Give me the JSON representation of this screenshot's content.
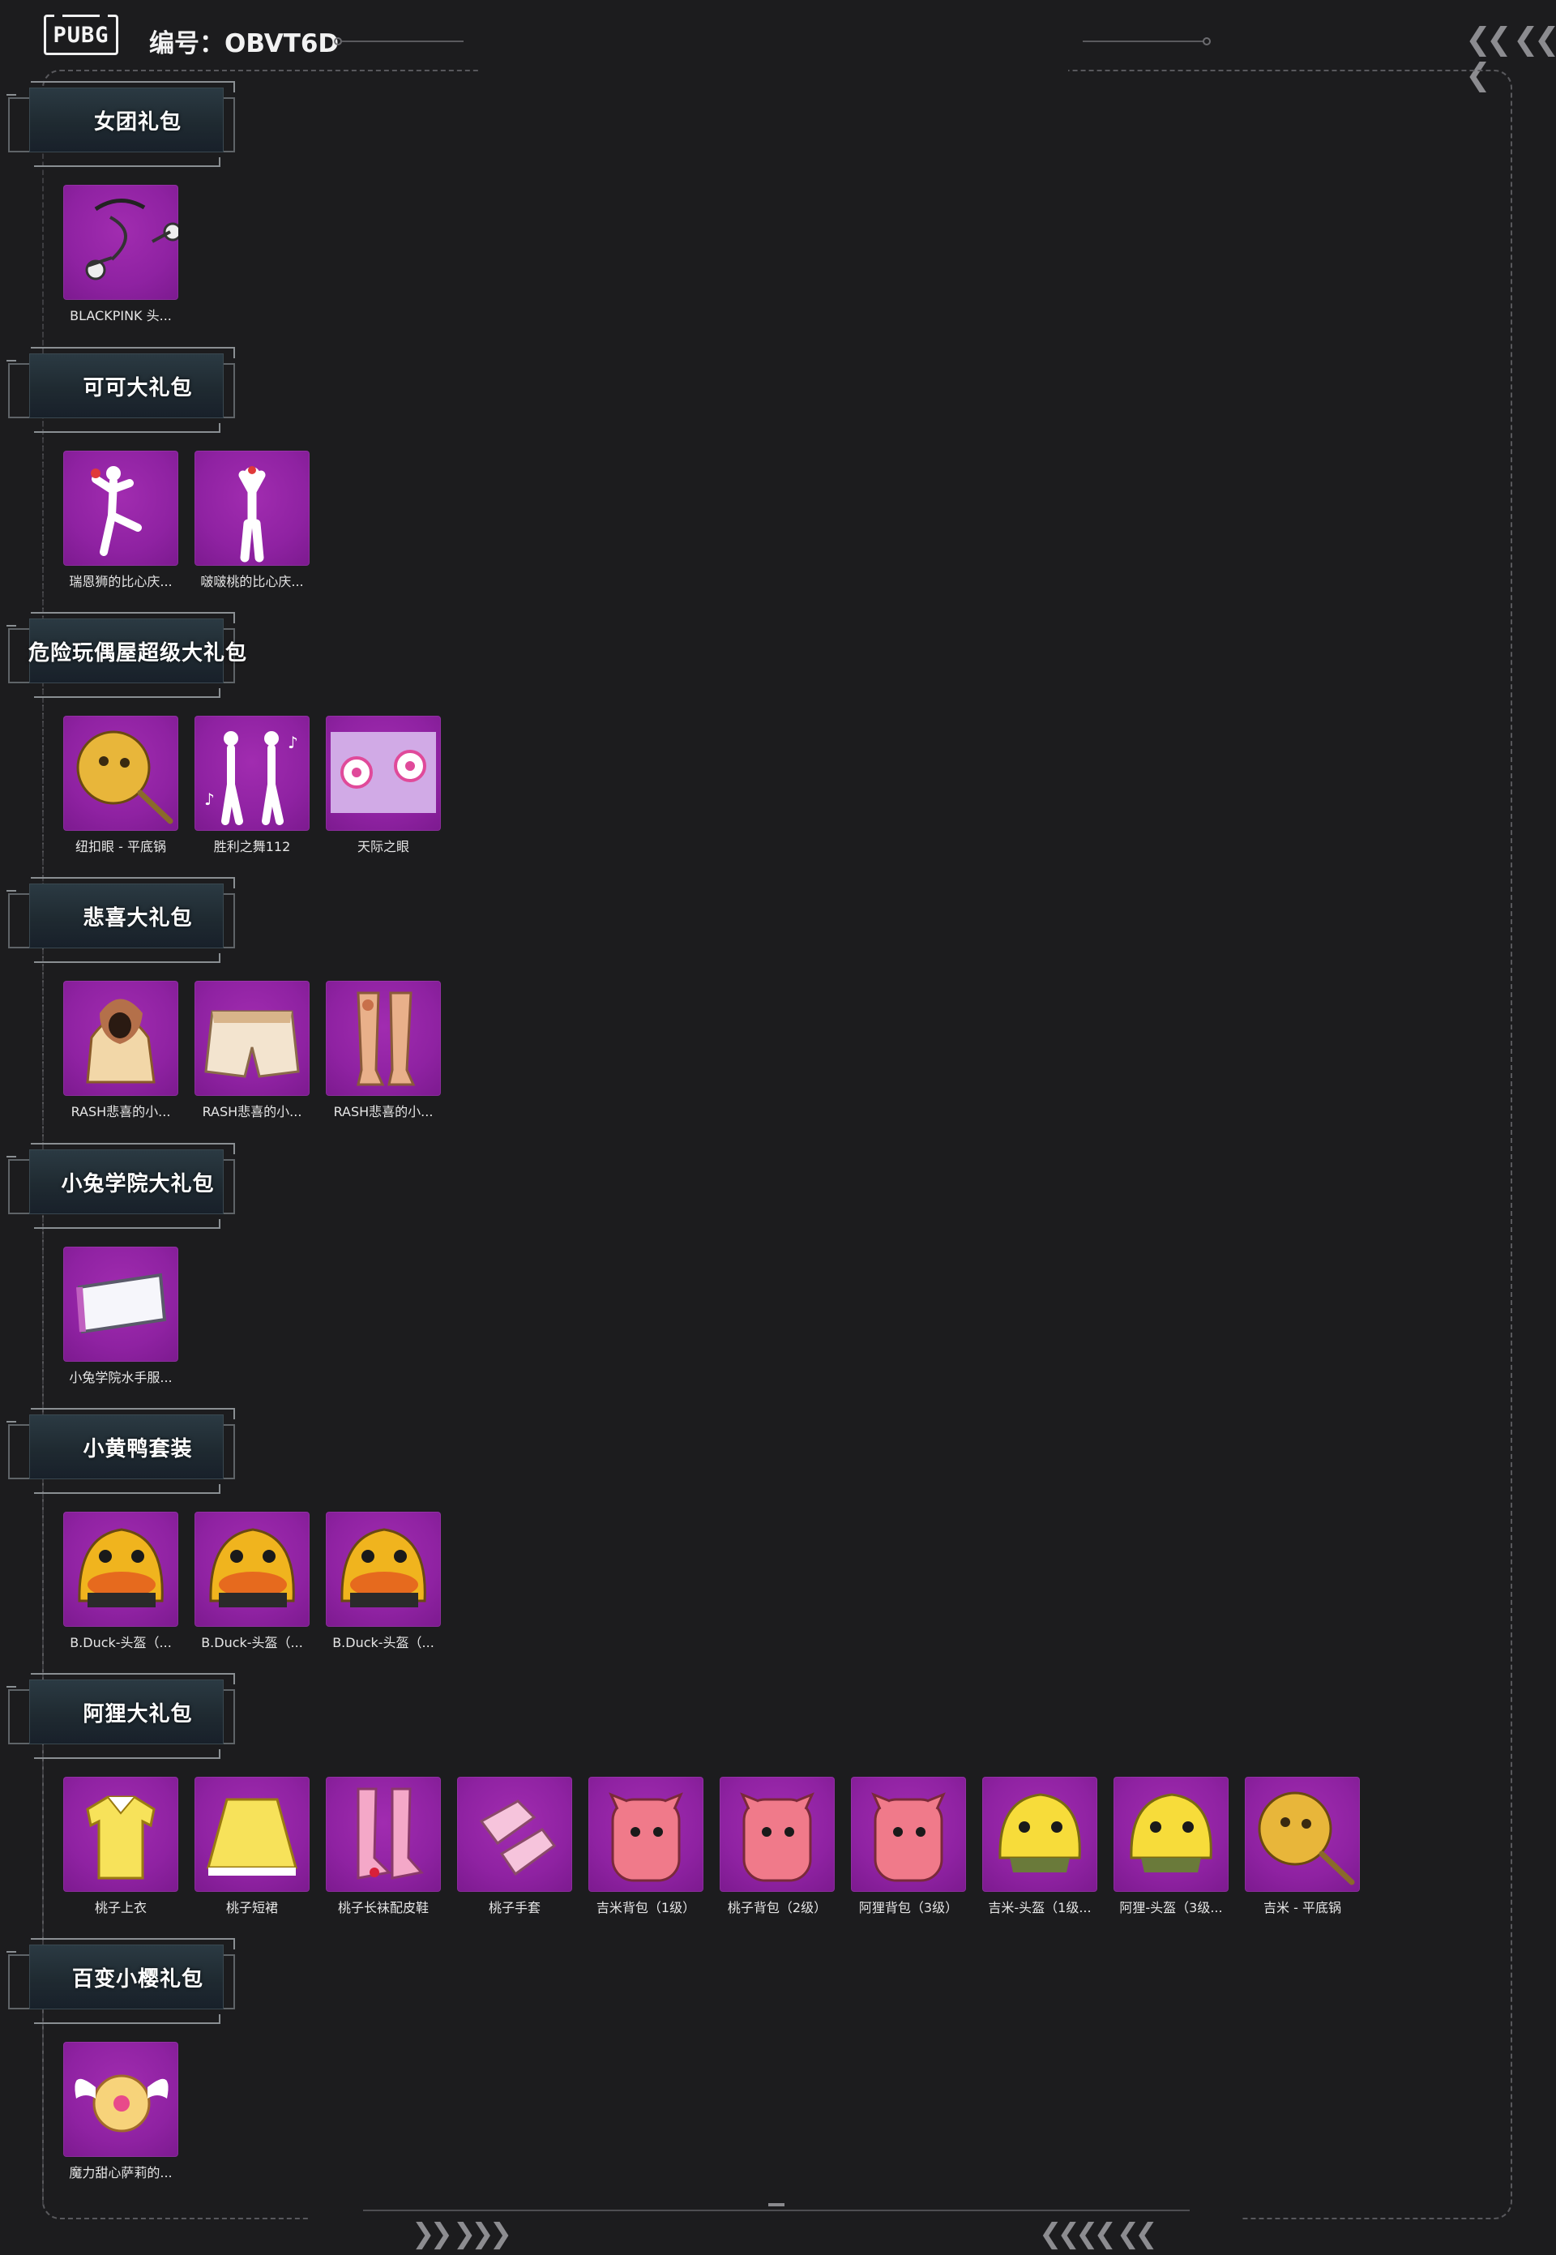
{
  "header": {
    "logo_text": "PUBG",
    "serial": "编号：OBVT6D"
  },
  "colors": {
    "background": "#1c1c1e",
    "tile_purple": "#9226a5",
    "frame_line": "#58585c",
    "header_plate": "#24313a"
  },
  "sections": [
    {
      "title": "女团礼包",
      "items": [
        {
          "label": "BLACKPINK 头...",
          "icon": "headset-icon"
        }
      ]
    },
    {
      "title": "可可大礼包",
      "items": [
        {
          "label": "瑞恩狮的比心庆...",
          "icon": "dance-kick-emote-icon"
        },
        {
          "label": "啵啵桃的比心庆...",
          "icon": "dance-heart-emote-icon"
        }
      ]
    },
    {
      "title": "危险玩偶屋超级大礼包",
      "items": [
        {
          "label": "纽扣眼 - 平底锅",
          "icon": "frying-pan-icon"
        },
        {
          "label": "胜利之舞112",
          "icon": "victory-dance-icon"
        },
        {
          "label": "天际之眼",
          "icon": "sky-eye-icon"
        }
      ]
    },
    {
      "title": "悲喜大礼包",
      "items": [
        {
          "label": "RASH悲喜的小...",
          "icon": "hoodie-icon"
        },
        {
          "label": "RASH悲喜的小...",
          "icon": "shorts-icon"
        },
        {
          "label": "RASH悲喜的小...",
          "icon": "stockings-icon"
        }
      ]
    },
    {
      "title": "小兔学院大礼包",
      "items": [
        {
          "label": "小兔学院水手服...",
          "icon": "sailor-mask-icon"
        }
      ]
    },
    {
      "title": "小黄鸭套装",
      "items": [
        {
          "label": "B.Duck-头盔（...",
          "icon": "duck-helmet-icon"
        },
        {
          "label": "B.Duck-头盔（...",
          "icon": "duck-helmet-icon"
        },
        {
          "label": "B.Duck-头盔（...",
          "icon": "duck-helmet-icon"
        }
      ]
    },
    {
      "title": "阿狸大礼包",
      "items": [
        {
          "label": "桃子上衣",
          "icon": "shirt-icon"
        },
        {
          "label": "桃子短裙",
          "icon": "skirt-icon"
        },
        {
          "label": "桃子长袜配皮鞋",
          "icon": "socks-shoes-icon"
        },
        {
          "label": "桃子手套",
          "icon": "gloves-icon"
        },
        {
          "label": "吉米背包（1级）",
          "icon": "backpack-icon"
        },
        {
          "label": "桃子背包（2级）",
          "icon": "backpack-icon"
        },
        {
          "label": "阿狸背包（3级）",
          "icon": "backpack-icon"
        },
        {
          "label": "吉米-头盔（1级...",
          "icon": "helmet-icon"
        },
        {
          "label": "阿狸-头盔（3级...",
          "icon": "helmet-icon"
        },
        {
          "label": "吉米 - 平底锅",
          "icon": "frying-pan-icon"
        }
      ]
    },
    {
      "title": "百变小樱礼包",
      "items": [
        {
          "label": "魔力甜心萨莉的...",
          "icon": "winged-backpack-icon"
        }
      ]
    }
  ]
}
